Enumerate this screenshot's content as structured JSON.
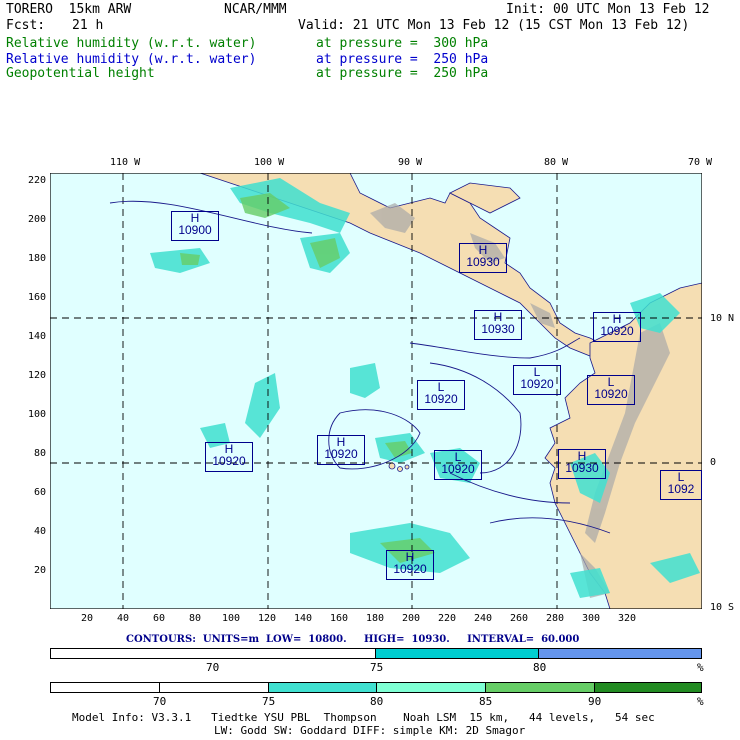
{
  "header": {
    "model": "TORERO  15km ARW",
    "org": "NCAR/MMM",
    "init": "Init: 00 UTC Mon 13 Feb 12",
    "fcst_label": "Fcst:",
    "fcst_value": "21 h",
    "valid": "Valid: 21 UTC Mon 13 Feb 12 (15 CST Mon 13 Feb 12)"
  },
  "fields": [
    {
      "name": "Relative humidity (w.r.t. water)",
      "level": "at pressure =  300 hPa",
      "color": "#008000"
    },
    {
      "name": "Relative humidity (w.r.t. water)",
      "level": "at pressure =  250 hPa",
      "color": "#0000cd"
    },
    {
      "name": "Geopotential height",
      "level": "at pressure =  250 hPa",
      "color": "#008000"
    }
  ],
  "map": {
    "lon_labels": [
      "110 W",
      "100 W",
      "90 W",
      "80 W",
      "70 W"
    ],
    "lat_labels": [
      "10 N",
      "0",
      "10 S"
    ],
    "x_ticks": [
      "20",
      "40",
      "60",
      "80",
      "100",
      "120",
      "140",
      "160",
      "180",
      "200",
      "220",
      "240",
      "260",
      "280",
      "300",
      "320"
    ],
    "y_ticks": [
      "220",
      "200",
      "180",
      "160",
      "140",
      "120",
      "100",
      "80",
      "60",
      "40",
      "20"
    ],
    "ocean_color": "#e0ffff",
    "land_color": "#f5deb3",
    "centers": [
      {
        "type": "H",
        "value": "10900"
      },
      {
        "type": "H",
        "value": "10930"
      },
      {
        "type": "H",
        "value": "10930"
      },
      {
        "type": "H",
        "value": "10920"
      },
      {
        "type": "L",
        "value": "10920"
      },
      {
        "type": "L",
        "value": "10920"
      },
      {
        "type": "L",
        "value": "10920"
      },
      {
        "type": "H",
        "value": "10920"
      },
      {
        "type": "H",
        "value": "10920"
      },
      {
        "type": "L",
        "value": "10920"
      },
      {
        "type": "H",
        "value": "10930"
      },
      {
        "type": "L",
        "value": "1092"
      },
      {
        "type": "H",
        "value": "10920"
      }
    ]
  },
  "contours": {
    "text": "CONTOURS:  UNITS=m  LOW=  10800.     HIGH=  10930.     INTERVAL=  60.000"
  },
  "colorbar1": {
    "segments": [
      {
        "color": "#ffffff"
      },
      {
        "color": "#00ced1"
      },
      {
        "color": "#6495ed"
      }
    ],
    "ticks": [
      "70",
      "75",
      "80",
      "%"
    ]
  },
  "colorbar2": {
    "segments": [
      {
        "color": "#ffffff"
      },
      {
        "color": "#ffffff"
      },
      {
        "color": "#40e0d0"
      },
      {
        "color": "#7fffd4"
      },
      {
        "color": "#66cd66"
      },
      {
        "color": "#228b22"
      }
    ],
    "ticks": [
      "70",
      "75",
      "80",
      "85",
      "90",
      "%"
    ]
  },
  "footer": {
    "line1": "Model Info: V3.3.1   Tiedtke YSU PBL  Thompson    Noah LSM  15 km,   44 levels,   54 sec",
    "line2": "LW: Godd SW: Goddard DIFF: simple KM: 2D Smagor"
  }
}
